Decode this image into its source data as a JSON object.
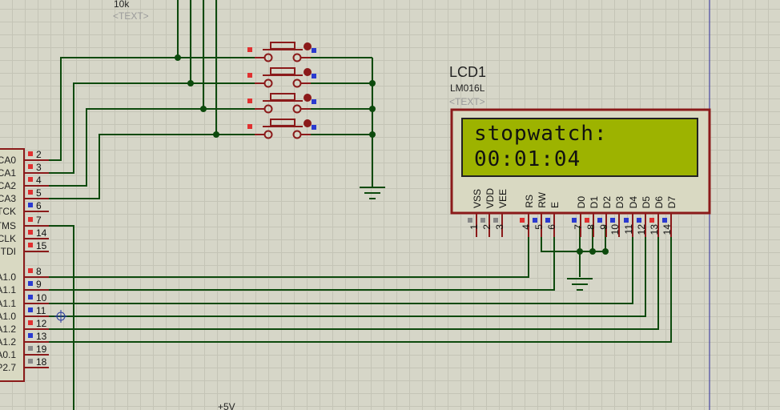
{
  "resistor": {
    "value": "10k",
    "text": "<TEXT>"
  },
  "lcd": {
    "ref": "LCD1",
    "model": "LM016L",
    "text_placeholder": "<TEXT>",
    "line1": "stopwatch:",
    "line2": "00:01:04",
    "pin_names": [
      "VSS",
      "VDD",
      "VEE",
      "RS",
      "RW",
      "E",
      "D0",
      "D1",
      "D2",
      "D3",
      "D4",
      "D5",
      "D6",
      "D7"
    ],
    "pin_numbers": [
      "1",
      "2",
      "3",
      "4",
      "5",
      "6",
      "7",
      "8",
      "9",
      "10",
      "11",
      "12",
      "13",
      "14"
    ]
  },
  "mcu": {
    "pin_labels": [
      "CA0",
      "CA1",
      "CA2",
      "CA3",
      "TCK",
      "TMS",
      "TCLK",
      "TDI",
      "A1.0",
      "A1.1",
      "A1.1",
      "A1.0",
      "A1.2",
      "A1.2",
      "A0.1",
      "P2.7"
    ],
    "pin_numbers": [
      "2",
      "3",
      "4",
      "5",
      "6",
      "7",
      "14",
      "15",
      "8",
      "9",
      "10",
      "11",
      "12",
      "13",
      "19",
      "18"
    ]
  },
  "power_label": "+5V",
  "colors": {
    "wire": "#0d4a0d",
    "component": "#8b1a1a",
    "lcd_screen": "#9db300",
    "lcd_body": "#d9d9c2"
  }
}
